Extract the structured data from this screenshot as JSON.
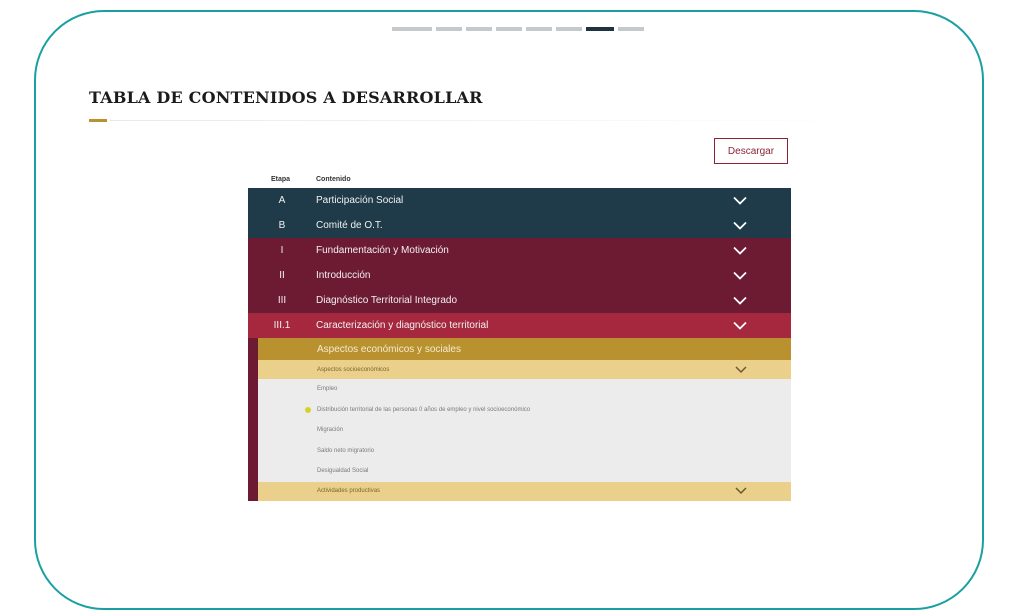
{
  "progress": {
    "total": 8,
    "active_index": 6
  },
  "page": {
    "title": "TABLA DE CONTENIDOS A DESARROLLAR",
    "download_label": "Descargar"
  },
  "table": {
    "headers": {
      "stage": "Etapa",
      "content": "Contenido"
    },
    "rows": [
      {
        "stage": "A",
        "label": "Participación Social"
      },
      {
        "stage": "B",
        "label": "Comité de O.T."
      },
      {
        "stage": "I",
        "label": "Fundamentación y Motivación"
      },
      {
        "stage": "II",
        "label": "Introducción"
      },
      {
        "stage": "III",
        "label": "Diagnóstico Territorial Integrado"
      },
      {
        "stage": "III.1",
        "label": "Caracterización y diagnóstico territorial"
      }
    ],
    "section": "Aspectos económicos y sociales",
    "subsection": "Aspectos socioeconómicos",
    "items": [
      "Empleo",
      "Distribución territorial de las personas 0 años de empleo y nivel socioeconómico",
      "Migración",
      "Saldo neto migratorio",
      "Desigualdad Social"
    ],
    "subsection2": "Actividades productivas"
  },
  "colors": {
    "frame": "#1aa0a2",
    "teal": "#1f3a48",
    "maroon": "#6d1a33",
    "red": "#a5283f",
    "gold": "#b9922f",
    "light_gold": "#ead08a"
  }
}
